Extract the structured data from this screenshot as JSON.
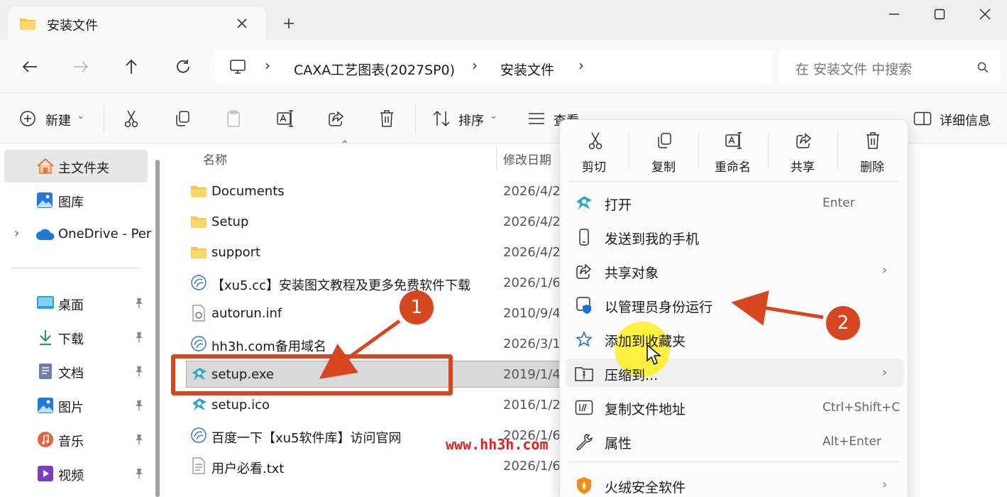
{
  "window": {
    "tab_title": "安装文件",
    "icons": [
      "folder-icon",
      "close-icon",
      "plus-icon",
      "minimize-icon",
      "maximize-icon",
      "close-window-icon"
    ]
  },
  "address": {
    "crumbs": [
      "CAXA工艺图表(2027SP0)",
      "安装文件"
    ],
    "search_placeholder": "在 安装文件 中搜索"
  },
  "toolbar": {
    "new_label": "新建",
    "sort_label": "排序",
    "view_label": "查看",
    "details_label": "详细信息"
  },
  "nav": {
    "home": "主文件夹",
    "gallery": "图库",
    "onedrive": "OneDrive - Per",
    "quick": [
      "桌面",
      "下载",
      "文档",
      "图片",
      "音乐",
      "视频"
    ]
  },
  "files": {
    "col_name": "名称",
    "col_date": "修改日期",
    "rows": [
      {
        "name": "Documents",
        "date": "2026/4/2",
        "icon": "folder-icon"
      },
      {
        "name": "Setup",
        "date": "2026/4/2",
        "icon": "folder-icon"
      },
      {
        "name": "support",
        "date": "2026/4/2",
        "icon": "folder-icon"
      },
      {
        "name": "【xu5.cc】安装图文教程及更多免费软件下载",
        "date": "2026/1/6",
        "icon": "url-shortcut-icon"
      },
      {
        "name": "autorun.inf",
        "date": "2010/9/4",
        "icon": "settings-file-icon"
      },
      {
        "name": "hh3h.com备用域名",
        "date": "2026/3/1",
        "icon": "url-shortcut-icon"
      },
      {
        "name": "setup.exe",
        "date": "2019/1/4",
        "icon": "app-icon"
      },
      {
        "name": "setup.ico",
        "date": "2016/1/2",
        "icon": "app-icon"
      },
      {
        "name": "百度一下【xu5软件库】访问官网",
        "date": "2026/1/6",
        "icon": "url-shortcut-icon"
      },
      {
        "name": "用户必看.txt",
        "date": "2026/1/6",
        "icon": "text-file-icon"
      }
    ]
  },
  "context_menu": {
    "quick_actions": [
      "剪切",
      "复制",
      "重命名",
      "共享",
      "删除"
    ],
    "items": [
      {
        "label": "打开",
        "shortcut": "Enter"
      },
      {
        "label": "发送到我的手机",
        "shortcut": ""
      },
      {
        "label": "共享对象",
        "shortcut": ""
      },
      {
        "label": "以管理员身份运行",
        "shortcut": ""
      },
      {
        "label": "添加到收藏夹",
        "shortcut": ""
      },
      {
        "label": "压缩到...",
        "shortcut": ""
      },
      {
        "label": "复制文件地址",
        "shortcut": "Ctrl+Shift+C"
      },
      {
        "label": "属性",
        "shortcut": "Alt+Enter"
      },
      {
        "label": "火绒安全软件",
        "shortcut": ""
      }
    ]
  },
  "annotations": {
    "badge1": "1",
    "badge2": "2",
    "watermark": "www.hh3h.com"
  },
  "colors": {
    "accent": "#d6461f",
    "folder": "#f5c542",
    "highlight": "#ffee1e"
  }
}
